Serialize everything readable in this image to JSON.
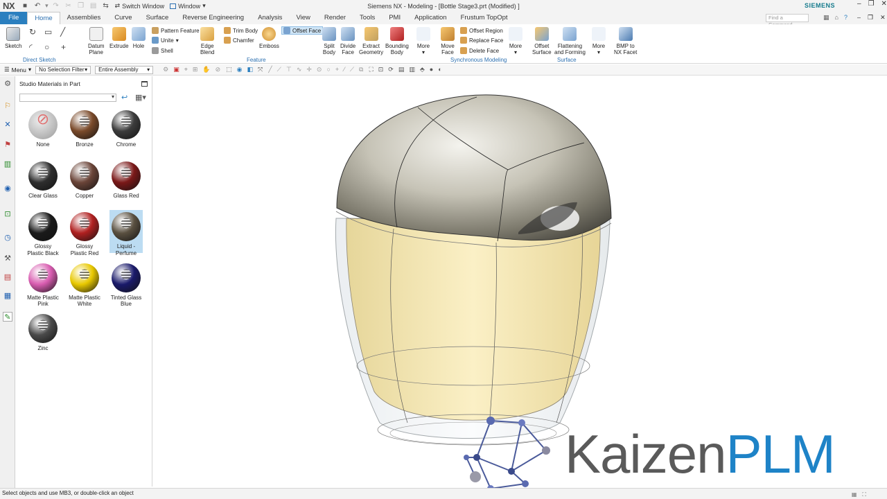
{
  "app": {
    "logo": "NX",
    "window_title": "Siemens NX - Modeling - [Bottle Stage3.prt (Modified) ]",
    "switch_window": "Switch Window",
    "window_menu": "Window",
    "brand": "SIEMENS"
  },
  "tabs": [
    "File",
    "Home",
    "Assemblies",
    "Curve",
    "Surface",
    "Reverse Engineering",
    "Analysis",
    "View",
    "Render",
    "Tools",
    "PMI",
    "Application",
    "Frustum TopOpt"
  ],
  "active_tab": "Home",
  "find_command_placeholder": "Find a Command",
  "ribbon": {
    "sketch": "Sketch",
    "direct_sketch_group": "Direct Sketch",
    "datum_plane": "Datum\nPlane",
    "extrude": "Extrude",
    "hole": "Hole",
    "pattern_feature": "Pattern Feature",
    "unite": "Unite",
    "shell": "Shell",
    "edge_blend": "Edge\nBlend",
    "trim_body": "Trim Body",
    "chamfer": "Chamfer",
    "emboss": "Emboss",
    "offset_face": "Offset Face",
    "feature_group": "Feature",
    "split_body": "Split\nBody",
    "divide_face": "Divide\nFace",
    "extract_geometry": "Extract\nGeometry",
    "bounding_body": "Bounding\nBody",
    "more1": "More",
    "move_face": "Move\nFace",
    "offset_region": "Offset Region",
    "replace_face": "Replace Face",
    "delete_face": "Delete Face",
    "more2": "More",
    "sync_group": "Synchronous Modeling",
    "offset_surface": "Offset\nSurface",
    "flattening": "Flattening\nand Forming",
    "more3": "More",
    "surface_group": "Surface",
    "bmp_nx": "BMP to\nNX Facet"
  },
  "selection_bar": {
    "menu": "Menu",
    "filter": "No Selection Filter",
    "scope": "Entire Assembly"
  },
  "panel": {
    "title": "Studio Materials in Part",
    "materials": [
      {
        "name": "None",
        "color": "#c8c8c8"
      },
      {
        "name": "Bronze",
        "color": "#7a4a2a"
      },
      {
        "name": "Chrome",
        "color": "#3c3c3c"
      },
      {
        "name": "Clear Glass",
        "color": "#2e2e2e"
      },
      {
        "name": "Copper",
        "color": "#6a4438"
      },
      {
        "name": "Glass Red",
        "color": "#7a1818"
      },
      {
        "name": "Glossy\nPlastic Black",
        "color": "#1a1a1a"
      },
      {
        "name": "Glossy\nPlastic Red",
        "color": "#b02020"
      },
      {
        "name": "Liquid -\nPerfume",
        "color": "#5a5040"
      },
      {
        "name": "Matte Plastic\nPink",
        "color": "#d85cb0"
      },
      {
        "name": "Matte Plastic\nWhite",
        "color": "#e8c800"
      },
      {
        "name": "Tinted Glass\nBlue",
        "color": "#1a1a6a"
      },
      {
        "name": "Zinc",
        "color": "#4a4a4a"
      }
    ],
    "selected": "Liquid -\nPerfume"
  },
  "watermark": {
    "part1": "Kaizen",
    "part2": "PLM"
  },
  "status": "Select objects and use MB3, or double-click an object",
  "colors": {
    "file_tab": "#2b7fbf",
    "accent": "#2b6fb0",
    "brand": "#157a8c",
    "kaizen_gray": "#5a5a5a",
    "kaizen_blue": "#1e83c7"
  }
}
